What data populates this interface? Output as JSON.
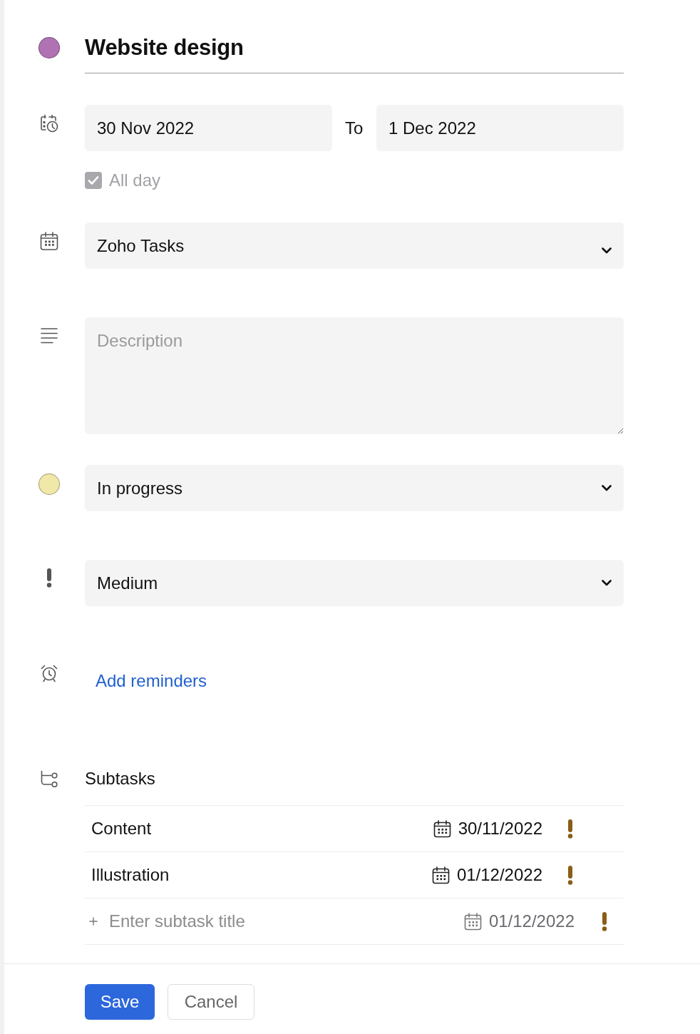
{
  "task": {
    "title": "Website design",
    "color": "#b072b2"
  },
  "dates": {
    "start": "30 Nov 2022",
    "separator": "To",
    "end": "1 Dec 2022",
    "all_day": {
      "label": "All day",
      "checked": true,
      "disabled": true
    }
  },
  "calendar": {
    "value": "Zoho Tasks"
  },
  "description": {
    "placeholder": "Description"
  },
  "status": {
    "value": "In progress",
    "color": "#efe8a8"
  },
  "priority": {
    "value": "Medium"
  },
  "reminders": {
    "link": "Add reminders"
  },
  "subtasks": {
    "label": "Subtasks",
    "items": [
      {
        "title": "Content",
        "due": "30/11/2022"
      },
      {
        "title": "Illustration",
        "due": "01/12/2022"
      }
    ],
    "new_item": {
      "placeholder": "Enter subtask title",
      "due": "01/12/2022"
    }
  },
  "buttons": [
    {
      "label": "Save",
      "kind": "primary"
    },
    {
      "label": "Cancel",
      "kind": "secondary"
    }
  ]
}
